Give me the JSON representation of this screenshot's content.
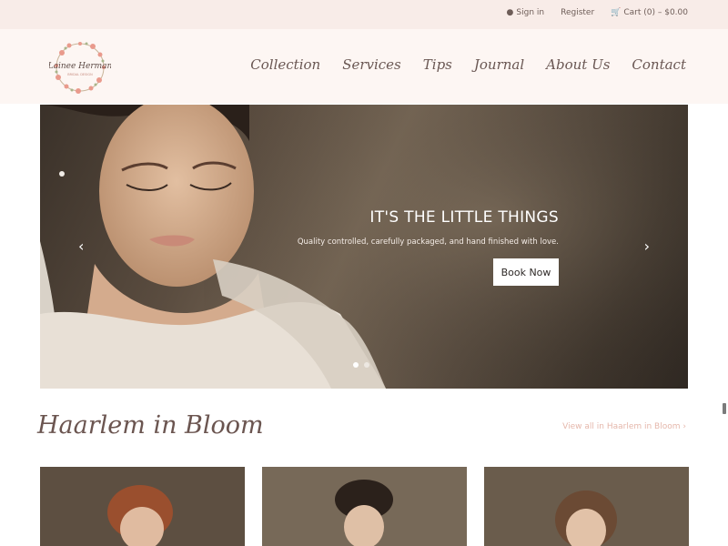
{
  "topbar": {
    "sign_in": "Sign in",
    "register": "Register",
    "cart": "Cart (0) – $0.00",
    "user_icon": "user-icon",
    "cart_icon": "cart-icon"
  },
  "brand": {
    "logo_name": "Lainee Herman",
    "logo_tagline": "BRIDAL DESIGN"
  },
  "nav": {
    "items": [
      "Collection",
      "Services",
      "Tips",
      "Journal",
      "About Us",
      "Contact"
    ]
  },
  "hero": {
    "title": "IT'S THE LITTLE THINGS",
    "subtitle": "Quality controlled, carefully packaged, and hand finished with love.",
    "button": "Book Now",
    "prev_icon": "chevron-left-icon",
    "next_icon": "chevron-right-icon",
    "slide_count": 2,
    "active_slide": 1
  },
  "section": {
    "title": "Haarlem in Bloom",
    "view_all": "View all in Haarlem in Bloom"
  },
  "colors": {
    "topbar_bg": "#f8ece8",
    "header_bg": "#fdf6f3",
    "accent": "#e5b7ab",
    "text": "#6b5550"
  }
}
